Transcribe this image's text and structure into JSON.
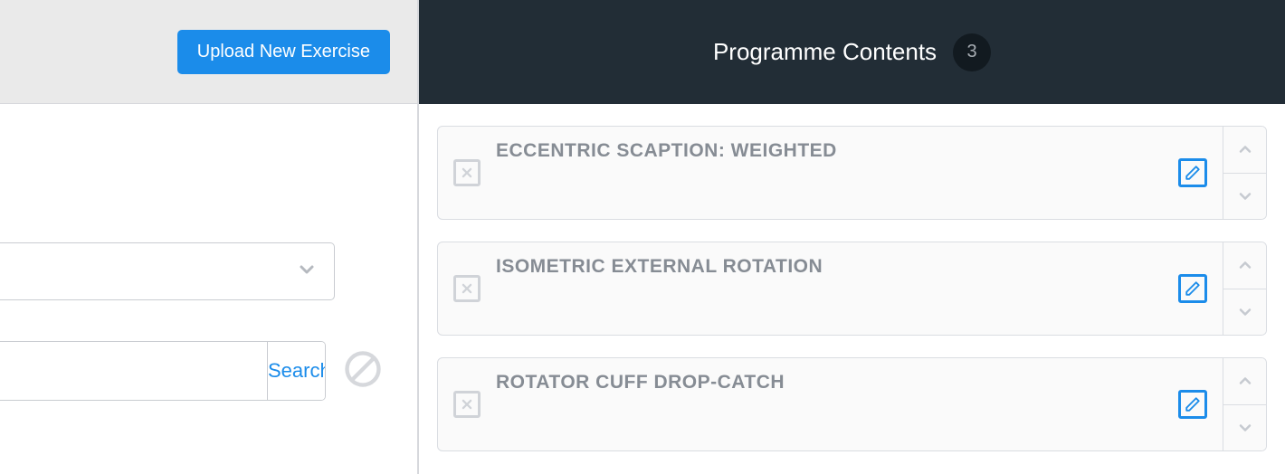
{
  "left": {
    "upload_label": "Upload New Exercise",
    "search_btn_label": "Search"
  },
  "right": {
    "title": "Programme Contents",
    "count": "3",
    "items": [
      {
        "name": "ECCENTRIC SCAPTION: WEIGHTED"
      },
      {
        "name": "ISOMETRIC EXTERNAL ROTATION"
      },
      {
        "name": "ROTATOR CUFF DROP-CATCH"
      }
    ]
  }
}
